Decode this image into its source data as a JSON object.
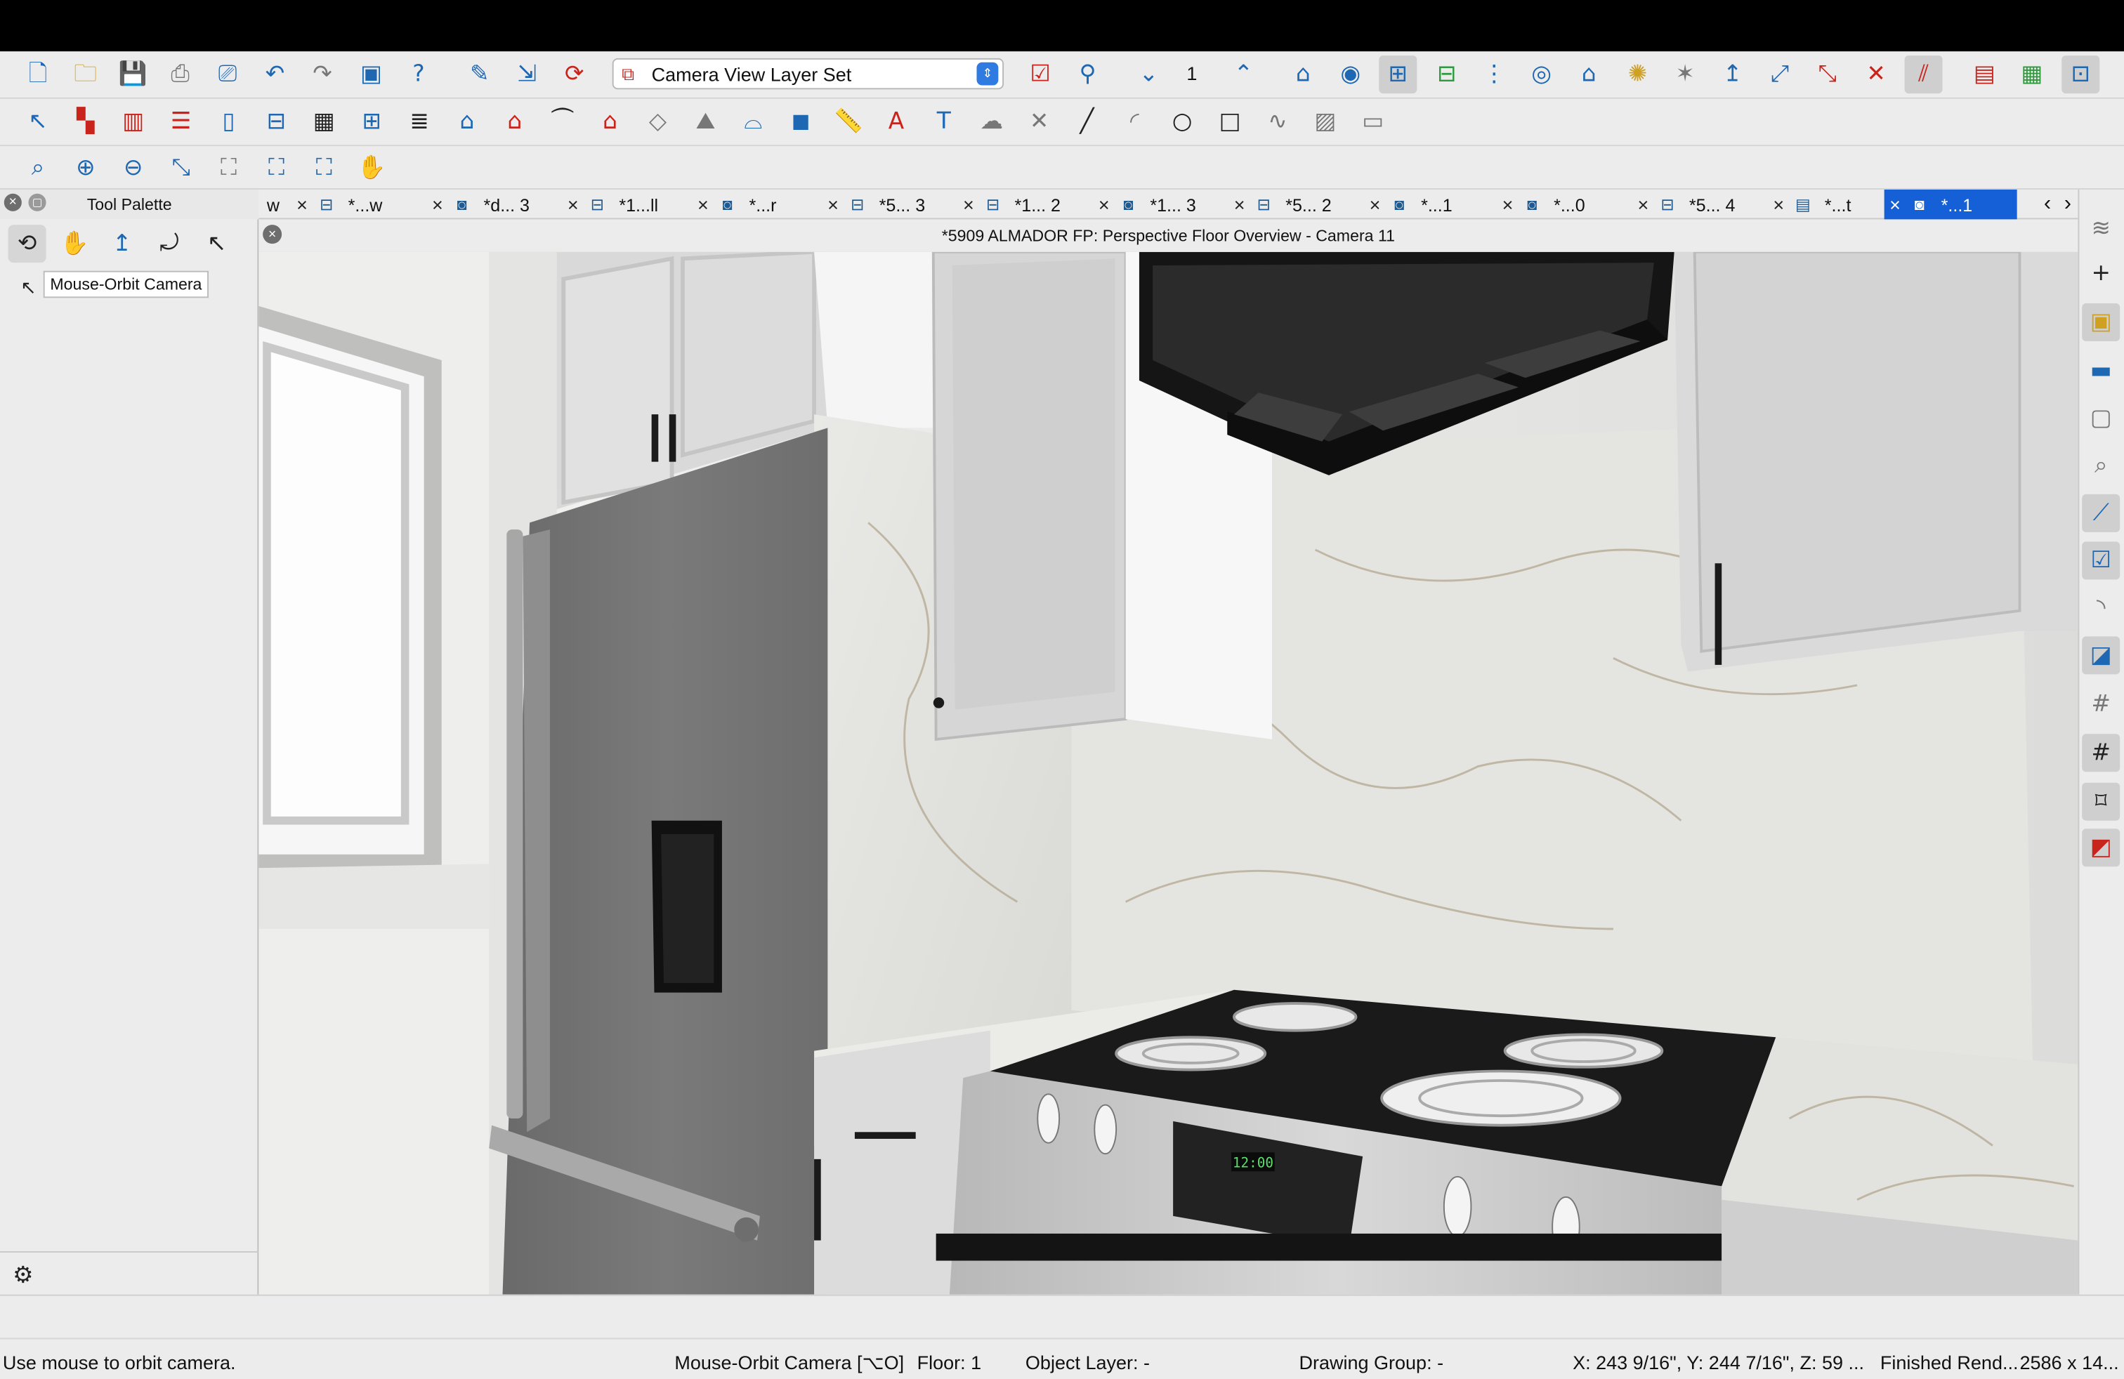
{
  "toolbar1": {
    "layer_set": "Camera View Layer Set",
    "page": "1",
    "icons": [
      "new-file-icon",
      "open-folder-icon",
      "save-icon",
      "print-icon",
      "print-preview-icon",
      "undo-icon",
      "redo-icon",
      "layout-icon",
      "help-icon",
      "edit-layout-icon",
      "send-to-layout-icon",
      "update-layout-icon",
      "layer-display-icon",
      "select-objects-icon",
      "down-one-floor-icon",
      "up-one-floor-icon",
      "floor-plan-icon",
      "camera-icon",
      "cross-section-icon",
      "elevation-icon",
      "walkthrough-icon",
      "perspective-icon",
      "full-overview-icon",
      "light-icon",
      "sun-angle-icon",
      "move-camera-icon",
      "edit-camera-icon",
      "camera-path-icon",
      "delete-camera-icon",
      "render-icon",
      "material-painter-icon",
      "plant-icon",
      "window-layout-icon"
    ]
  },
  "toolbar2": {
    "icons": [
      "select-arrow-icon",
      "wall-tools-icon",
      "railing-icon",
      "stairs-icon",
      "door-icon",
      "window-icon",
      "cabinet-icon",
      "fixture-icon",
      "floor-icon",
      "roof-icon",
      "house-icon",
      "gable-icon",
      "dormer-icon",
      "slab-icon",
      "terrain-icon",
      "framing-icon",
      "3d-box-icon",
      "dimension-icon",
      "text-arrow-icon",
      "text-icon",
      "cloud-icon",
      "cad-x-icon",
      "line-icon",
      "arc-icon",
      "circle-icon",
      "rectangle-icon",
      "spline-icon",
      "image-icon",
      "cad-block-icon"
    ]
  },
  "toolbar3": {
    "icons": [
      "zoom-window-icon",
      "zoom-in-icon",
      "zoom-out-icon",
      "undo-zoom-icon",
      "fill-window-icon",
      "fill-window-building-icon",
      "fill-window-all-icon",
      "pan-icon"
    ]
  },
  "palette": {
    "title": "Tool Palette",
    "tooltip": "Mouse-Orbit Camera",
    "tools": [
      "mouse-orbit-camera-icon",
      "pan-hand-icon",
      "move-camera-icon",
      "orbit-around-icon",
      "rotate-camera-icon"
    ]
  },
  "tabs": [
    {
      "label": "w",
      "icon": ""
    },
    {
      "label": "*...w",
      "icon": "plan"
    },
    {
      "label": "*d... 3",
      "icon": "camera"
    },
    {
      "label": "*1...ll",
      "icon": "plan"
    },
    {
      "label": "*...r",
      "icon": "camera"
    },
    {
      "label": "*5... 3",
      "icon": "plan"
    },
    {
      "label": "*1... 2",
      "icon": "plan"
    },
    {
      "label": "*1... 3",
      "icon": "camera"
    },
    {
      "label": "*5... 2",
      "icon": "plan"
    },
    {
      "label": "*...1",
      "icon": "camera"
    },
    {
      "label": "*...0",
      "icon": "camera"
    },
    {
      "label": "*5... 4",
      "icon": "plan"
    },
    {
      "label": "*...t",
      "icon": "elev"
    },
    {
      "label": "*...1",
      "icon": "camera",
      "active": true
    }
  ],
  "view": {
    "title": "*5909 ALMADOR FP: Perspective Floor Overview - Camera 11",
    "clock": "12:00"
  },
  "rightbar": {
    "icons": [
      "layers-icon",
      "add-icon",
      "material-check-icon",
      "wall-check-icon",
      "window-check-icon",
      "zoom-check-icon",
      "dimension-check-icon",
      "text-check-icon",
      "arc-check-icon",
      "chart-check-icon",
      "grid-icon",
      "grid-check-icon",
      "node-check-icon",
      "terrain-check-icon"
    ]
  },
  "status": {
    "hint": "Use mouse to orbit camera.",
    "tool": "Mouse-Orbit Camera [⌥O]",
    "floor": "Floor: 1",
    "layer": "Object Layer: -",
    "group": "Drawing Group: -",
    "coords": "X: 243 9/16\", Y: 244 7/16\", Z: 59 ...",
    "render": "Finished Rend...",
    "size": "2586 x 14..."
  }
}
